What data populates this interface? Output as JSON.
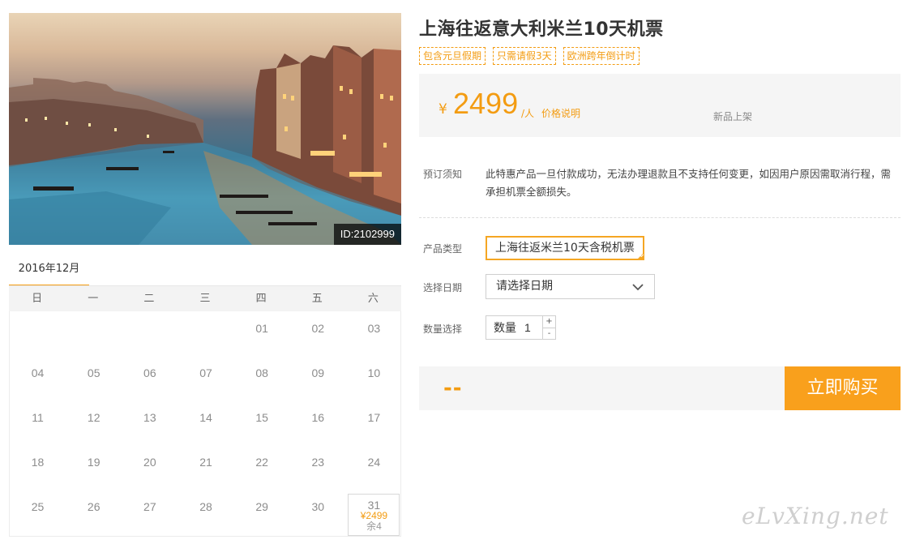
{
  "product": {
    "title": "上海往返意大利米兰10天机票",
    "tags": [
      "包含元旦假期",
      "只需请假3天",
      "欧洲跨年倒计时"
    ],
    "image_id": "ID:2102999"
  },
  "price": {
    "currency": "¥",
    "amount": "2499",
    "unit": "/人",
    "note_link": "价格说明",
    "badge": "新品上架"
  },
  "booking_notice": {
    "label": "预订须知",
    "text": "此特惠产品一旦付款成功，无法办理退款且不支持任何变更，如因用户原因需取消行程，需承担机票全额损失。"
  },
  "form": {
    "product_type_label": "产品类型",
    "product_type_value": "上海往返米兰10天含税机票",
    "date_label": "选择日期",
    "date_placeholder": "请选择日期",
    "quantity_label": "数量选择",
    "quantity_field_label": "数量",
    "quantity_value": "1",
    "increment": "+",
    "decrement": "-"
  },
  "total": {
    "value": "--"
  },
  "buy_button": "立即购买",
  "calendar": {
    "month_tab": "2016年12月",
    "weekdays": [
      "日",
      "一",
      "二",
      "三",
      "四",
      "五",
      "六"
    ],
    "rows": [
      [
        "",
        "",
        "",
        "",
        "01",
        "02",
        "03"
      ],
      [
        "04",
        "05",
        "06",
        "07",
        "08",
        "09",
        "10"
      ],
      [
        "11",
        "12",
        "13",
        "14",
        "15",
        "16",
        "17"
      ],
      [
        "18",
        "19",
        "20",
        "21",
        "22",
        "23",
        "24"
      ],
      [
        "25",
        "26",
        "27",
        "28",
        "29",
        "30",
        "31"
      ]
    ],
    "special": {
      "day": "31",
      "price": "¥2499",
      "stock": "余4"
    }
  },
  "watermark": "eLvXing.net",
  "colors": {
    "accent": "#f39c12",
    "button": "#f9a01c"
  }
}
